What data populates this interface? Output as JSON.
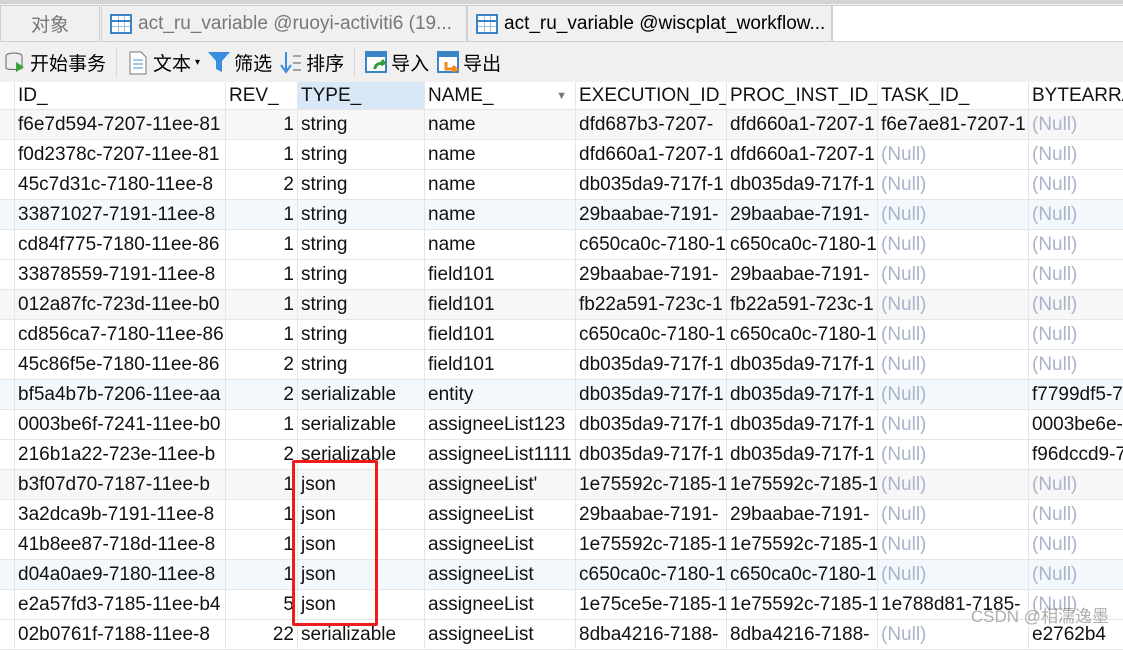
{
  "tabs": [
    {
      "label": "对象",
      "active": false
    },
    {
      "label": "act_ru_variable @ruoyi-activiti6 (19...",
      "active": false
    },
    {
      "label": "act_ru_variable @wiscplat_workflow...",
      "active": true
    }
  ],
  "toolbar": {
    "begin_transaction": "开始事务",
    "text": "文本",
    "filter": "筛选",
    "sort": "排序",
    "import": "导入",
    "export": "导出"
  },
  "columns": [
    "ID_",
    "REV_",
    "TYPE_",
    "NAME_",
    "EXECUTION_ID_",
    "PROC_INST_ID_",
    "TASK_ID_",
    "BYTEARRA"
  ],
  "rows": [
    [
      "f6e7d594-7207-11ee-81",
      "1",
      "string",
      "name",
      "dfd687b3-7207-",
      "dfd660a1-7207-1",
      "f6e7ae81-7207-1",
      "(Null)"
    ],
    [
      "f0d2378c-7207-11ee-81",
      "1",
      "string",
      "name",
      "dfd660a1-7207-1",
      "dfd660a1-7207-1",
      "(Null)",
      "(Null)"
    ],
    [
      "45c7d31c-7180-11ee-8",
      "2",
      "string",
      "name",
      "db035da9-717f-1",
      "db035da9-717f-1",
      "(Null)",
      "(Null)"
    ],
    [
      "33871027-7191-11ee-8",
      "1",
      "string",
      "name",
      "29baabae-7191-",
      "29baabae-7191-",
      "(Null)",
      "(Null)"
    ],
    [
      "cd84f775-7180-11ee-86",
      "1",
      "string",
      "name",
      "c650ca0c-7180-1",
      "c650ca0c-7180-1",
      "(Null)",
      "(Null)"
    ],
    [
      "33878559-7191-11ee-8",
      "1",
      "string",
      "field101",
      "29baabae-7191-",
      "29baabae-7191-",
      "(Null)",
      "(Null)"
    ],
    [
      "012a87fc-723d-11ee-b0",
      "1",
      "string",
      "field101",
      "fb22a591-723c-1",
      "fb22a591-723c-1",
      "(Null)",
      "(Null)"
    ],
    [
      "cd856ca7-7180-11ee-86",
      "1",
      "string",
      "field101",
      "c650ca0c-7180-1",
      "c650ca0c-7180-1",
      "(Null)",
      "(Null)"
    ],
    [
      "45c86f5e-7180-11ee-86",
      "2",
      "string",
      "field101",
      "db035da9-717f-1",
      "db035da9-717f-1",
      "(Null)",
      "(Null)"
    ],
    [
      "bf5a4b7b-7206-11ee-aa",
      "2",
      "serializable",
      "entity",
      "db035da9-717f-1",
      "db035da9-717f-1",
      "(Null)",
      "f7799df5-7"
    ],
    [
      "0003be6f-7241-11ee-b0",
      "1",
      "serializable",
      "assigneeList123",
      "db035da9-717f-1",
      "db035da9-717f-1",
      "(Null)",
      "0003be6e-"
    ],
    [
      "216b1a22-723e-11ee-b",
      "2",
      "serializable",
      "assigneeList1111",
      "db035da9-717f-1",
      "db035da9-717f-1",
      "(Null)",
      "f96dccd9-7"
    ],
    [
      "b3f07d70-7187-11ee-b",
      "1",
      "json",
      "assigneeList'",
      "1e75592c-7185-1",
      "1e75592c-7185-1",
      "(Null)",
      "(Null)"
    ],
    [
      "3a2dca9b-7191-11ee-8",
      "1",
      "json",
      "assigneeList",
      "29baabae-7191-",
      "29baabae-7191-",
      "(Null)",
      "(Null)"
    ],
    [
      "41b8ee87-718d-11ee-8",
      "1",
      "json",
      "assigneeList",
      "1e75592c-7185-1",
      "1e75592c-7185-1",
      "(Null)",
      "(Null)"
    ],
    [
      "d04a0ae9-7180-11ee-8",
      "1",
      "json",
      "assigneeList",
      "c650ca0c-7180-1",
      "c650ca0c-7180-1",
      "(Null)",
      "(Null)"
    ],
    [
      "e2a57fd3-7185-11ee-b4",
      "5",
      "json",
      "assigneeList",
      "1e75ce5e-7185-1",
      "1e75592c-7185-1",
      "1e788d81-7185-",
      "(Null)"
    ],
    [
      "02b0761f-7188-11ee-8",
      "22",
      "serializable",
      "assigneeList",
      "8dba4216-7188-",
      "8dba4216-7188-",
      "(Null)",
      "e2762b4"
    ]
  ],
  "watermark": "CSDN @相濡逸墨",
  "colors": {
    "highlight": "#ee1c1c",
    "null_text": "#a9b3c9",
    "selected_header": "#d9e8f7"
  }
}
